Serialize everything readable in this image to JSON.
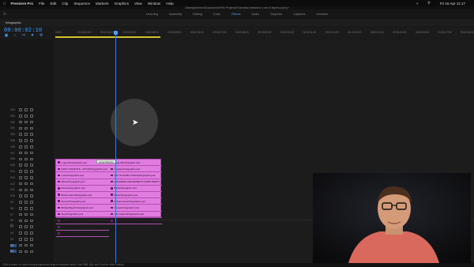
{
  "menubar": {
    "apple": "",
    "app_name": "Premiere Pro",
    "items": [
      "File",
      "Edit",
      "Clip",
      "Sequence",
      "Markers",
      "Graphics",
      "View",
      "Window",
      "Help"
    ],
    "datetime": "Fri 16 Apr  11:17"
  },
  "window_title": "/Users/jkoenen/Documents/Film Projects/Transition between a set of layers.prproj *",
  "workspaces": [
    "Learning",
    "Assembly",
    "Editing",
    "Color",
    "Effects",
    "Audio",
    "Graphics",
    "Captions",
    "Libraries"
  ],
  "active_workspace": "Effects",
  "sequence_tab": "Infographic",
  "timecode": "00:00:02:10",
  "ruler_ticks": [
    "00:00",
    "00:00:01:00",
    "00:00:02:00",
    "00:00:03:00",
    "00:00:04:00",
    "00:00:05:00",
    "00:00:06:00",
    "00:00:07:00",
    "00:00:08:00",
    "00:00:09:00",
    "00:00:10:00",
    "00:00:11:00",
    "00:00:12:00",
    "00:00:13:00",
    "00:00:14:00",
    "00:00:15:00",
    "00:00:16:00",
    "00:00:17:00",
    "00:00:18:00"
  ],
  "video_tracks": [
    "V24",
    "V23",
    "V22",
    "V21",
    "V20",
    "V19",
    "V18",
    "V17",
    "V16",
    "V15",
    "V14",
    "V13",
    "V12",
    "V11",
    "V10",
    "V9",
    "V8",
    "V7",
    "V6",
    "V5",
    "V4",
    "V3",
    "V2",
    "V1"
  ],
  "audio_track": "A1",
  "transition_label": "Cross Dissolve",
  "clips_left": [
    "Logo-01/Infographic.psd",
    "HNDY-COMPUTE...ATTOR/Infographic.psd",
    "Lines/Infographic.psd",
    "Wheel/Infographic.psd",
    "Rotary/Infographic.psd",
    "British Gaunt/Infographic.psd",
    "Arrows/Infographic.psd",
    "Bubble/Beach/Infographic.psd",
    "Stop/Infographic.psd",
    "Sample/Infographic.psd",
    "Field/Infographic.psd",
    "Background/Infographic.psd"
  ],
  "clips_right": [
    "Logo-02/Infographic.psd",
    "Updates/Infographic.psd",
    "WE TR-EVIRO-ATHLE/Infographic.psd",
    "MANWENE MANGEMENT-COMPUTER/IT...",
    "Bank/Infographic.psd",
    "British/Infographic.psd",
    "Drawer areas/Infographic.psd",
    "Planets/Infographic.psd",
    "Life Caption/Infographic.psd",
    "Lat Yellow Halftone/Infographic.psd"
  ],
  "status_text": "Click to select, or click in empty space and drag to marquee select. Use Shift, Opt, and Cmd for other options.",
  "colors": {
    "accent": "#4f9cf0",
    "clip": "#e07be0",
    "work_area": "#d4c42a"
  }
}
